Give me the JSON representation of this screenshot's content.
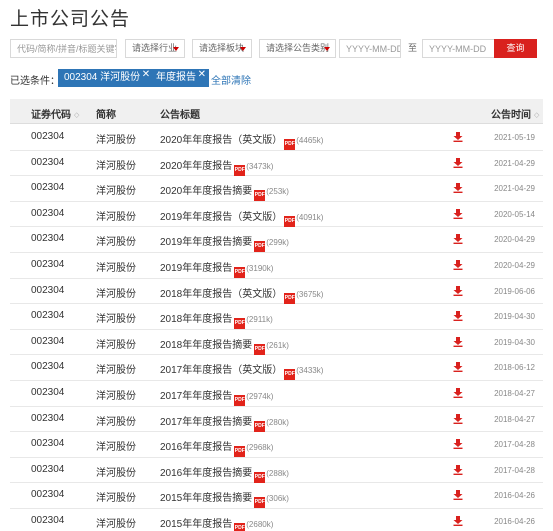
{
  "page": {
    "title": "上市公司公告"
  },
  "filters": {
    "search_placeholder": "代码/简称/拼音/标题关键字",
    "industry_label": "请选择行业",
    "sector_label": "请选择板块",
    "type_label": "请选择公告类别",
    "date_from_placeholder": "YYYY-MM-DD",
    "date_sep": "至",
    "date_to_placeholder": "YYYY-MM-DD",
    "query_label": "查询"
  },
  "selected": {
    "label": "已选条件：",
    "tags": [
      {
        "text": "002304 洋河股份"
      },
      {
        "text": "年度报告"
      }
    ],
    "clear_label": "全部清除"
  },
  "table": {
    "headers": {
      "code": "证券代码",
      "name": "简称",
      "title": "公告标题",
      "date": "公告时间"
    },
    "pdf_label": "PDF",
    "rows": [
      {
        "code": "002304",
        "name": "洋河股份",
        "title": "2020年年度报告（英文版）",
        "size": "(4465k)",
        "date": "2021-05-19"
      },
      {
        "code": "002304",
        "name": "洋河股份",
        "title": "2020年年度报告",
        "size": "(3473k)",
        "date": "2021-04-29"
      },
      {
        "code": "002304",
        "name": "洋河股份",
        "title": "2020年年度报告摘要",
        "size": "(253k)",
        "date": "2021-04-29"
      },
      {
        "code": "002304",
        "name": "洋河股份",
        "title": "2019年年度报告（英文版）",
        "size": "(4091k)",
        "date": "2020-05-14"
      },
      {
        "code": "002304",
        "name": "洋河股份",
        "title": "2019年年度报告摘要",
        "size": "(299k)",
        "date": "2020-04-29"
      },
      {
        "code": "002304",
        "name": "洋河股份",
        "title": "2019年年度报告",
        "size": "(3190k)",
        "date": "2020-04-29"
      },
      {
        "code": "002304",
        "name": "洋河股份",
        "title": "2018年年度报告（英文版）",
        "size": "(3675k)",
        "date": "2019-06-06"
      },
      {
        "code": "002304",
        "name": "洋河股份",
        "title": "2018年年度报告",
        "size": "(2911k)",
        "date": "2019-04-30"
      },
      {
        "code": "002304",
        "name": "洋河股份",
        "title": "2018年年度报告摘要",
        "size": "(261k)",
        "date": "2019-04-30"
      },
      {
        "code": "002304",
        "name": "洋河股份",
        "title": "2017年年度报告（英文版）",
        "size": "(3433k)",
        "date": "2018-06-12"
      },
      {
        "code": "002304",
        "name": "洋河股份",
        "title": "2017年年度报告",
        "size": "(2974k)",
        "date": "2018-04-27"
      },
      {
        "code": "002304",
        "name": "洋河股份",
        "title": "2017年年度报告摘要",
        "size": "(280k)",
        "date": "2018-04-27"
      },
      {
        "code": "002304",
        "name": "洋河股份",
        "title": "2016年年度报告",
        "size": "(2968k)",
        "date": "2017-04-28"
      },
      {
        "code": "002304",
        "name": "洋河股份",
        "title": "2016年年度报告摘要",
        "size": "(288k)",
        "date": "2017-04-28"
      },
      {
        "code": "002304",
        "name": "洋河股份",
        "title": "2015年年度报告摘要",
        "size": "(306k)",
        "date": "2016-04-26"
      },
      {
        "code": "002304",
        "name": "洋河股份",
        "title": "2015年年度报告",
        "size": "(2680k)",
        "date": "2016-04-26"
      }
    ]
  },
  "colors": {
    "accent_red": "#d9211e",
    "tag_blue": "#2e75b6",
    "pdf_red": "#e2231a"
  },
  "icons": {
    "download": "download-icon",
    "pdf": "pdf-icon",
    "sort": "sort-icon",
    "close": "close-icon"
  }
}
